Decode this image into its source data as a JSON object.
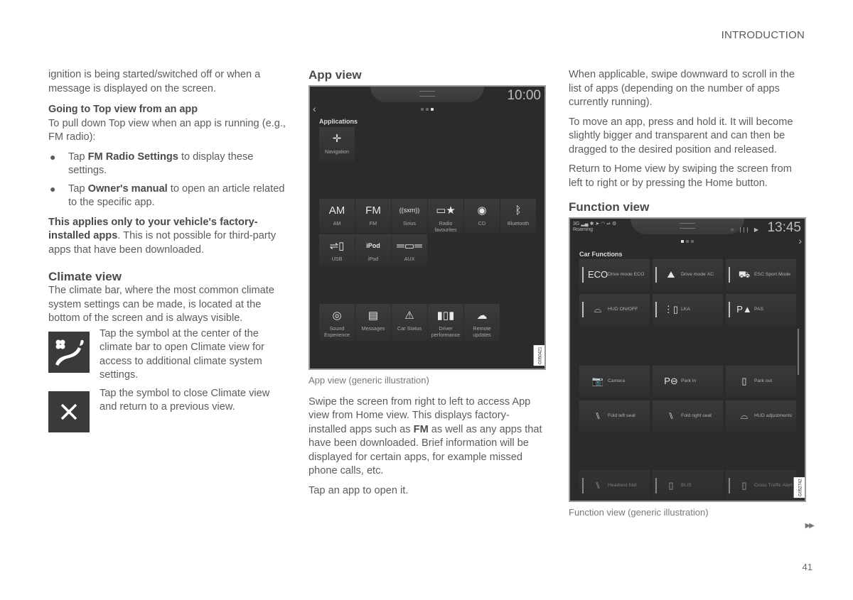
{
  "header": {
    "section": "INTRODUCTION"
  },
  "col1": {
    "intro": "ignition is being started/switched off or when a message is displayed on the screen.",
    "top_view_heading": "Going to Top view from an app",
    "top_view_text": "To pull down Top view when an app is running (e.g., FM radio):",
    "bullets": [
      {
        "pre": "Tap ",
        "bold": "FM Radio Settings",
        "post": " to display these settings."
      },
      {
        "pre": "Tap ",
        "bold": "Owner's manual",
        "post": " to open an article related to the specific app."
      }
    ],
    "note_bold": "This applies only to your vehicle's factory-installed apps",
    "note_rest": ". This is not possible for third-party apps that have been downloaded.",
    "climate_heading": "Climate view",
    "climate_text": "The climate bar, where the most common climate system settings can be made, is located at the bottom of the screen and is always visible.",
    "climate_items": [
      {
        "icon": "climate-icon",
        "text": "Tap the symbol at the center of the climate bar to open Climate view for access to additional climate system settings."
      },
      {
        "icon": "close-icon",
        "text": "Tap the symbol to close Climate view and return to a previous view."
      }
    ]
  },
  "col2": {
    "heading": "App view",
    "screen": {
      "clock": "10:00",
      "title": "Applications",
      "navigation_label": "Navigation",
      "apps_row1": [
        {
          "glyph": "AM",
          "label": "AM",
          "icon": "am-radio-icon"
        },
        {
          "glyph": "FM",
          "label": "FM",
          "icon": "fm-radio-icon"
        },
        {
          "glyph": "((sxm))",
          "label": "Sirius",
          "icon": "sirius-icon"
        },
        {
          "glyph": "▭★",
          "label": "Radio favourites",
          "icon": "radio-favourites-icon"
        },
        {
          "glyph": "◉",
          "label": "CD",
          "icon": "cd-icon"
        },
        {
          "glyph": "ᛒ",
          "label": "Bluetooth",
          "icon": "bluetooth-icon"
        }
      ],
      "apps_row2": [
        {
          "glyph": "⇌▯",
          "label": "USB",
          "icon": "usb-icon"
        },
        {
          "glyph": "iPod",
          "label": "iPod",
          "icon": "ipod-icon"
        },
        {
          "glyph": "═▭═",
          "label": "AUX",
          "icon": "aux-icon"
        }
      ],
      "apps_row3": [
        {
          "glyph": "◎",
          "label": "Sound Experience",
          "icon": "speaker-icon"
        },
        {
          "glyph": "▤",
          "label": "Messages",
          "icon": "messages-icon"
        },
        {
          "glyph": "⚠",
          "label": "Car Status",
          "icon": "car-status-icon"
        },
        {
          "glyph": "▮▯▮",
          "label": "Driver performance",
          "icon": "driver-performance-icon"
        },
        {
          "glyph": "☁",
          "label": "Remote updates",
          "icon": "cloud-download-icon"
        }
      ],
      "image_code": "G050421"
    },
    "caption": "App view (generic illustration)",
    "para1_pre": "Swipe the screen from right to left to access App view from Home view. This displays factory-installed apps such as ",
    "para1_bold": "FM",
    "para1_post": " as well as any apps that have been downloaded. Brief information will be displayed for certain apps, for example missed phone calls, etc.",
    "para2": "Tap an app to open it."
  },
  "col3": {
    "para1": "When applicable, swipe downward to scroll in the list of apps (depending on the number of apps currently running).",
    "para2": "To move an app, press and hold it. It will become slightly bigger and transparent and can then be dragged to the desired position and released.",
    "para3": "Return to Home view by swiping the screen from left to right or by pressing the Home button.",
    "heading": "Function view",
    "screen": {
      "status_left": "3G ▂▄ ✱ ➤ ◠ ⇌ ⚙",
      "roaming": "Roaming",
      "status_right": "○ ||| ▶",
      "clock": "13:45",
      "title": "Car Functions",
      "functions": [
        {
          "glyph": "ECO",
          "label": "Drive mode ECO",
          "icon": "eco-icon"
        },
        {
          "glyph": "⛰",
          "label": "Drive mode XC",
          "icon": "drive-mode-xc-icon"
        },
        {
          "glyph": "⛟",
          "label": "ESC Sport Mode",
          "icon": "esc-off-icon"
        },
        {
          "glyph": "⌓",
          "label": "HUD ON/OFF",
          "icon": "hud-icon"
        },
        {
          "glyph": "⋮▯",
          "label": "LKA",
          "icon": "lane-keeping-icon"
        },
        {
          "glyph": "P▲",
          "label": "PAS",
          "icon": "park-assist-icon"
        },
        {
          "glyph": "📷",
          "label": "Camera",
          "icon": "camera-icon"
        },
        {
          "glyph": "P⊖",
          "label": "Park in",
          "icon": "park-in-icon"
        },
        {
          "glyph": "▯",
          "label": "Park out",
          "icon": "park-out-icon"
        },
        {
          "glyph": "⑊",
          "label": "Fold left seat",
          "icon": "fold-left-seat-icon"
        },
        {
          "glyph": "⑊",
          "label": "Fold right seat",
          "icon": "fold-right-seat-icon"
        },
        {
          "glyph": "⌓",
          "label": "HUD adjustments",
          "icon": "hud-adjust-icon"
        },
        {
          "glyph": "⑊",
          "label": "Headrest fold",
          "icon": "headrest-fold-icon"
        },
        {
          "glyph": "▯",
          "label": "BLIS",
          "icon": "blis-icon"
        },
        {
          "glyph": "▯",
          "label": "Cross Traffic Alert",
          "icon": "cross-traffic-alert-icon"
        }
      ],
      "image_code": "G052742"
    },
    "caption": "Function view (generic illustration)"
  },
  "footer": {
    "next_indicator": "▶▶",
    "page_number": "41"
  }
}
